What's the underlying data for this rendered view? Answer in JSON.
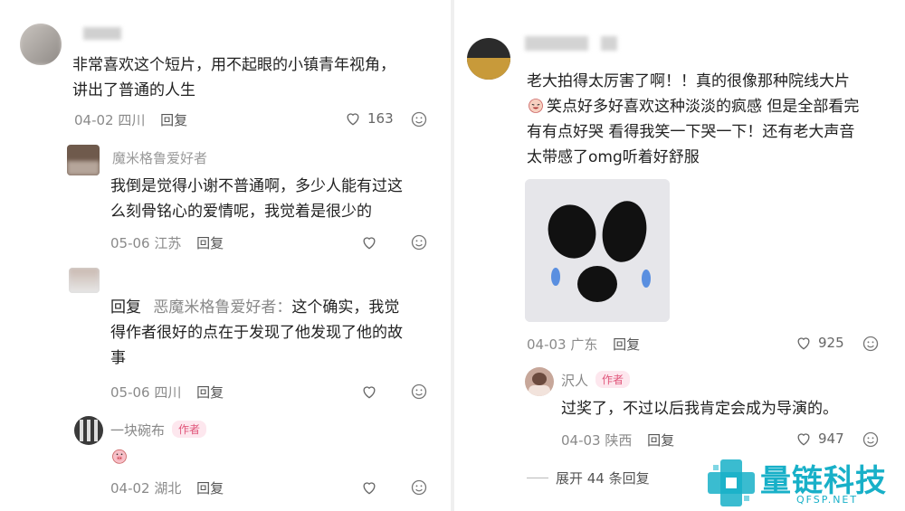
{
  "left": {
    "c1": {
      "text_l1": "非常喜欢这个短片，用不起眼的小镇青年视角，",
      "text_l2": "讲出了普通的人生",
      "date": "04-02",
      "loc": "四川",
      "reply": "回复",
      "likes": "163"
    },
    "c2": {
      "name_partial": "魔米格鲁爱好者",
      "text_l1": "我倒是觉得小谢不普通啊，多少人能有过这",
      "text_l2": "么刻骨铭心的爱情呢，我觉着是很少的",
      "date": "05-06",
      "loc": "江苏",
      "reply": "回复"
    },
    "c3": {
      "reply_prefix": "回复",
      "reply_to": "恶魔米格鲁爱好者：",
      "text_l1_rest": "这个确实，我觉",
      "text_l2": "得作者很好的点在于发现了他发现了他的故",
      "text_l3": "事",
      "date": "05-06",
      "loc": "四川",
      "reply": "回复"
    },
    "c4": {
      "name": "一块碗布",
      "badge": "作者",
      "date": "04-02",
      "loc": "湖北",
      "reply": "回复"
    }
  },
  "right": {
    "c1": {
      "text_l1": "老大拍得太厉害了啊！！真的很像那种院线大片",
      "text_l2": "笑点好多好喜欢这种淡淡的疯感 但是全部看完",
      "text_l3": "有有点好哭 看得我笑一下哭一下！还有老大声音",
      "text_l4": "太带感了omg听着好舒服",
      "date": "04-03",
      "loc": "广东",
      "reply": "回复",
      "likes": "925"
    },
    "c2": {
      "name": "沢人",
      "badge": "作者",
      "text": "过奖了，不过以后我肯定会成为导演的。",
      "date": "04-03",
      "loc": "陕西",
      "reply": "回复",
      "likes": "947"
    },
    "expand": "展开 44 条回复"
  },
  "watermark": {
    "title": "量链科技",
    "sub": "QFSP.NET"
  },
  "colors": {
    "accent": "#18b0c8",
    "badge_text": "#e0557a",
    "badge_bg": "#fde7ee"
  }
}
